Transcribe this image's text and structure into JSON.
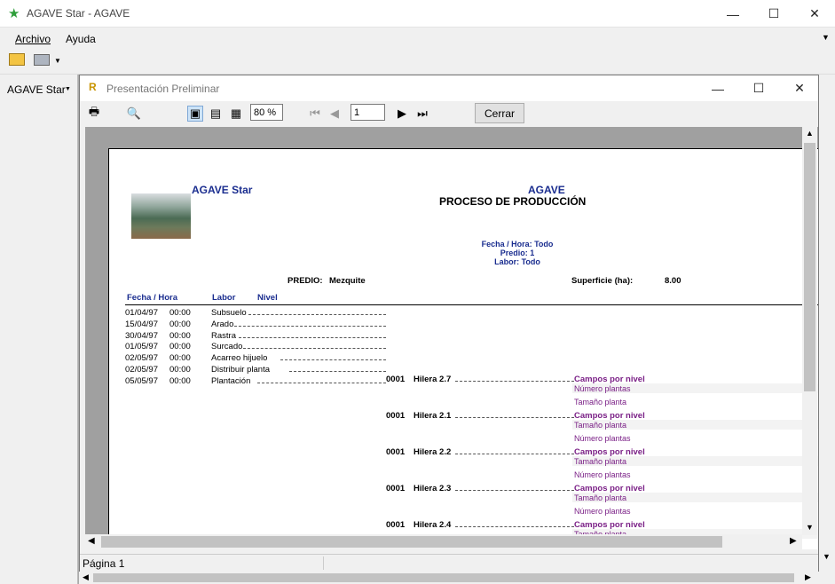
{
  "app": {
    "title": "AGAVE Star - AGAVE",
    "star_color": "#2e9e3a"
  },
  "menu": {
    "archivo": "Archivo",
    "ayuda": "Ayuda"
  },
  "left_nav": {
    "label": "AGAVE Star"
  },
  "preview": {
    "title": "Presentación Preliminar",
    "zoom": "80 %",
    "page_input": "1",
    "close_label": "Cerrar",
    "status": "Página 1"
  },
  "report": {
    "company": "AGAVE Star",
    "header_title": "AGAVE",
    "subtitle": "PROCESO DE PRODUCCIÓN",
    "filters": [
      "Fecha / Hora: Todo",
      "Predio: 1",
      "Labor: Todo"
    ],
    "predio_label": "PREDIO:",
    "predio_value": "Mezquite",
    "superficie_label": "Superficie (ha):",
    "superficie_value": "8.00",
    "col_fecha": "Fecha / Hora",
    "col_labor": "Labor",
    "col_nivel": "Nivel",
    "rows": [
      {
        "date": "01/04/97",
        "time": "00:00",
        "labor": "Subsuelo"
      },
      {
        "date": "15/04/97",
        "time": "00:00",
        "labor": "Arado"
      },
      {
        "date": "30/04/97",
        "time": "00:00",
        "labor": "Rastra"
      },
      {
        "date": "01/05/97",
        "time": "00:00",
        "labor": "Surcado"
      },
      {
        "date": "02/05/97",
        "time": "00:00",
        "labor": "Acarreo hijuelo"
      },
      {
        "date": "02/05/97",
        "time": "00:00",
        "labor": "Distribuir planta"
      },
      {
        "date": "05/05/97",
        "time": "00:00",
        "labor": "Plantación"
      }
    ],
    "hileras": [
      {
        "code": "0001",
        "name": "Hilera 2.7"
      },
      {
        "code": "0001",
        "name": "Hilera 2.1"
      },
      {
        "code": "0001",
        "name": "Hilera 2.2"
      },
      {
        "code": "0001",
        "name": "Hilera 2.3"
      },
      {
        "code": "0001",
        "name": "Hilera 2.4"
      }
    ],
    "campos_label": "Campos por nivel",
    "numero_label": "Número plantas",
    "tamano_label": "Tamaño planta"
  }
}
